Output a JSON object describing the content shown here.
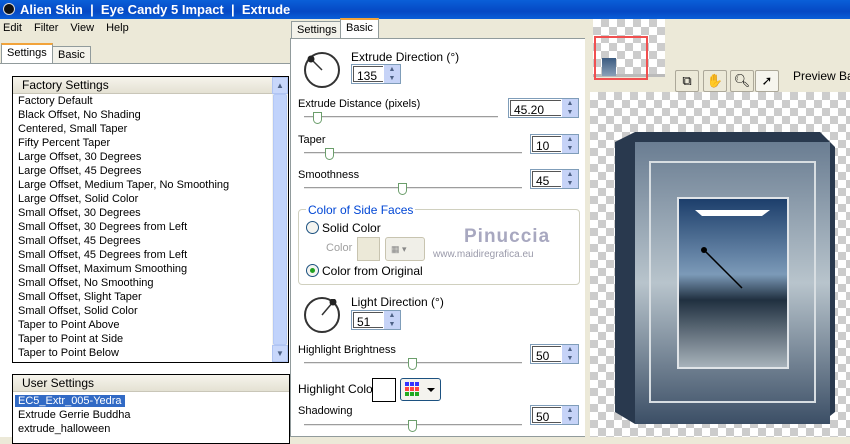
{
  "window": {
    "title": "Alien Skin  |  Eye Candy 5 Impact  |  Extrude"
  },
  "menu": [
    "Edit",
    "Filter",
    "View",
    "Help"
  ],
  "left_tabs": [
    "Settings",
    "Basic"
  ],
  "factory": {
    "header": "Factory Settings",
    "items": [
      "Factory Default",
      "Black Offset, No Shading",
      "Centered, Small Taper",
      "Fifty Percent Taper",
      "Large Offset, 30 Degrees",
      "Large Offset, 45 Degrees",
      "Large Offset, Medium Taper, No Smoothing",
      "Large Offset, Solid Color",
      "Small Offset, 30 Degrees",
      "Small Offset, 30 Degrees from Left",
      "Small Offset, 45 Degrees",
      "Small Offset, 45 Degrees from Left",
      "Small Offset, Maximum Smoothing",
      "Small Offset, No Smoothing",
      "Small Offset, Slight Taper",
      "Small Offset, Solid Color",
      "Taper to Point Above",
      "Taper to Point at Side",
      "Taper to Point Below"
    ]
  },
  "user": {
    "header": "User Settings",
    "items": [
      "EC5_Extr_005-Yedra",
      "Extrude Gerrie Buddha",
      "extrude_halloween"
    ],
    "selected": 0
  },
  "mid_tabs": [
    "Settings",
    "Basic"
  ],
  "basic": {
    "extrude_direction": {
      "label": "Extrude Direction (°)",
      "value": "135"
    },
    "extrude_distance": {
      "label": "Extrude Distance (pixels)",
      "value": "45.20",
      "pct": 5
    },
    "taper": {
      "label": "Taper",
      "value": "10",
      "pct": 10
    },
    "smoothness": {
      "label": "Smoothness",
      "value": "45",
      "pct": 45
    },
    "side_faces": {
      "label": "Color of Side Faces",
      "solid": "Solid Color",
      "color_label": "Color",
      "original": "Color from Original",
      "selected": "original",
      "swatch": "#ece9d8"
    },
    "light_direction": {
      "label": "Light Direction (°)",
      "value": "51"
    },
    "highlight_brightness": {
      "label": "Highlight Brightness",
      "value": "50",
      "pct": 50
    },
    "highlight_color": {
      "label": "Highlight Color",
      "swatch": "#ffffff"
    },
    "shadowing": {
      "label": "Shadowing",
      "value": "50",
      "pct": 50
    }
  },
  "watermark": {
    "name": "Pinuccia",
    "url": "www.maidiregrafica.eu"
  },
  "preview": {
    "label": "Preview Bac",
    "tools": [
      "preview-toggle",
      "hand",
      "zoom",
      "pointer"
    ]
  }
}
